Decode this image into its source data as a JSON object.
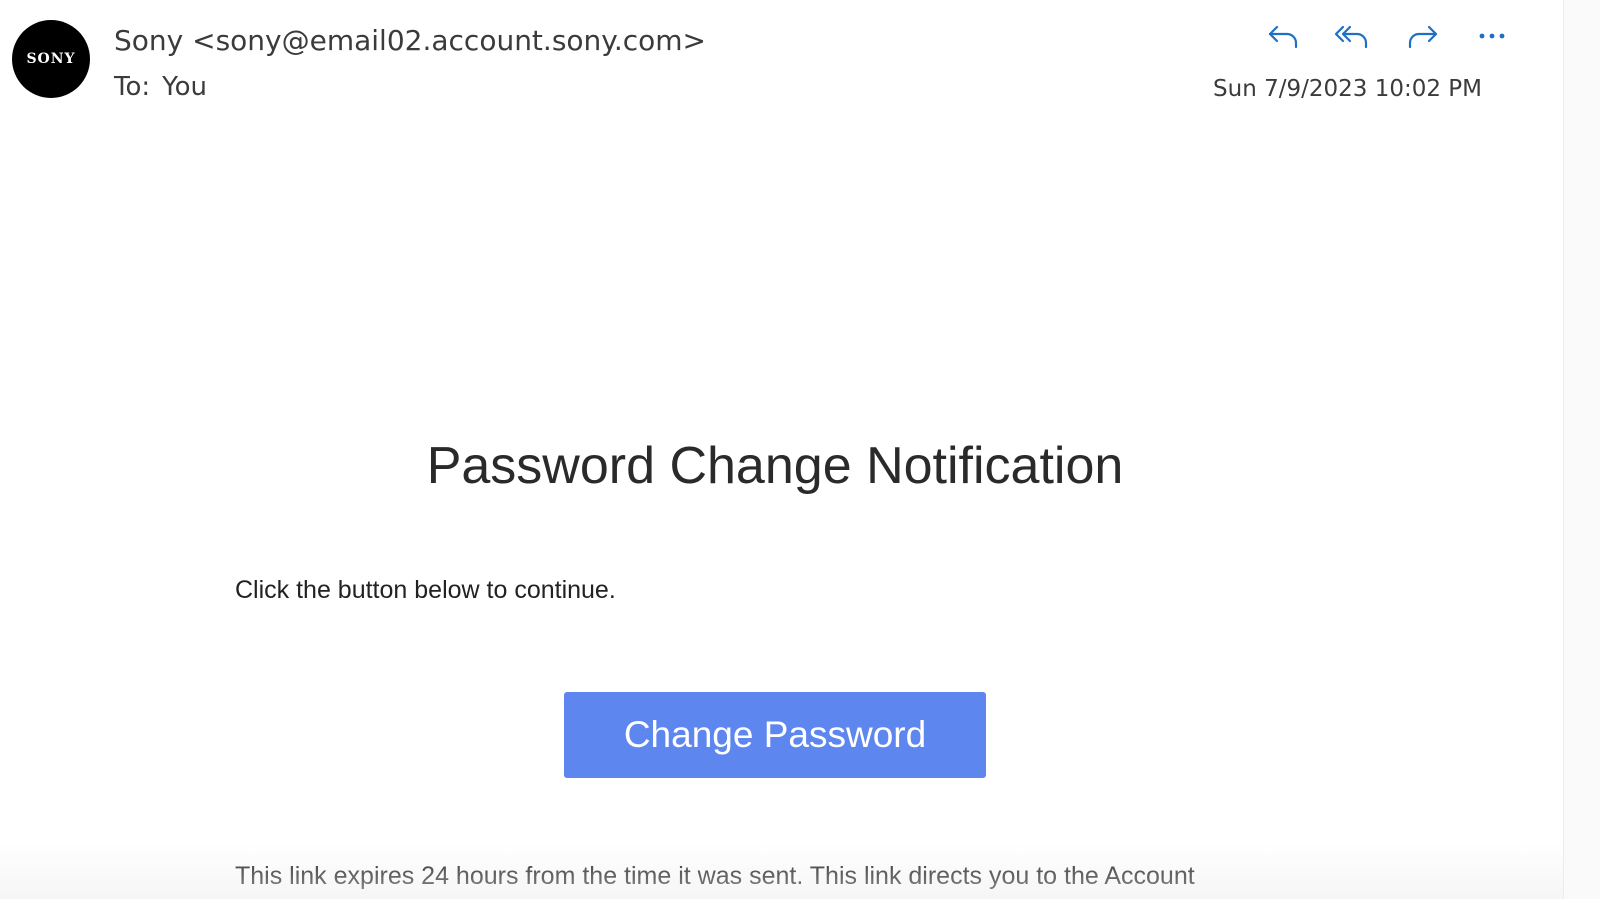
{
  "header": {
    "avatar_text": "SONY",
    "sender": "Sony <sony@email02.account.sony.com>",
    "to_label": "To:",
    "to_value": "You",
    "timestamp": "Sun 7/9/2023 10:02 PM",
    "actions": [
      {
        "icon": "reply-icon"
      },
      {
        "icon": "reply-all-icon"
      },
      {
        "icon": "forward-icon"
      },
      {
        "icon": "more-options-icon"
      }
    ],
    "accent_color": "#1f6fc5"
  },
  "body": {
    "title": "Password Change Notification",
    "instruction": "Click the button below to continue.",
    "button_label": "Change Password",
    "button_color": "#5d86ef",
    "footer_text": "This link expires 24 hours from the time it was sent. This link directs you to the Account"
  }
}
